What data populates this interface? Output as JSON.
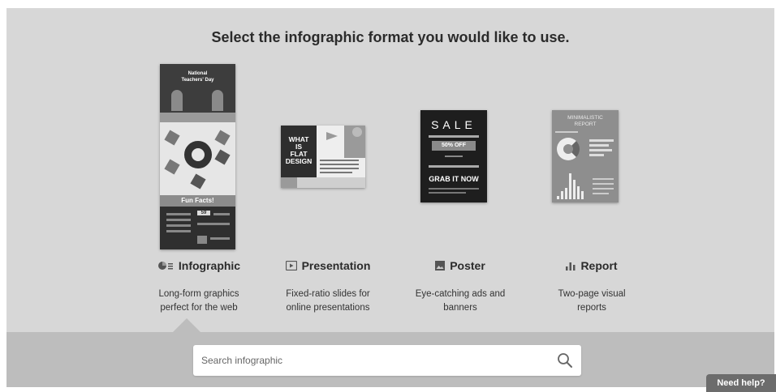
{
  "heading": "Select the infographic format you would like to use.",
  "formats": [
    {
      "label": "Infographic",
      "icon": "infographic-icon",
      "desc_lines": [
        "Long-form graphics",
        "perfect for the web"
      ],
      "thumb_texts": [
        "National",
        "Teachers' Day",
        "Fun Facts!",
        "59"
      ]
    },
    {
      "label": "Presentation",
      "icon": "presentation-icon",
      "desc_lines": [
        "Fixed-ratio slides for",
        "online presentations"
      ],
      "thumb_texts": [
        "WHAT",
        "IS",
        "FLAT",
        "DESIGN"
      ]
    },
    {
      "label": "Poster",
      "icon": "poster-icon",
      "desc_lines": [
        "Eye-catching ads and",
        "banners"
      ],
      "thumb_texts": [
        "SALE",
        "50% OFF",
        "GRAB IT NOW"
      ]
    },
    {
      "label": "Report",
      "icon": "report-icon",
      "desc_lines": [
        "Two-page visual",
        "reports"
      ],
      "thumb_texts": [
        "MINIMALISTIC",
        "REPORT"
      ]
    }
  ],
  "selected_format": "Infographic",
  "search": {
    "placeholder": "Search infographic",
    "value": ""
  },
  "help_label": "Need help?",
  "colors": {
    "panel": "#d7d7d7",
    "search_bar": "#bdbdbd",
    "help": "#6c6c6c"
  }
}
